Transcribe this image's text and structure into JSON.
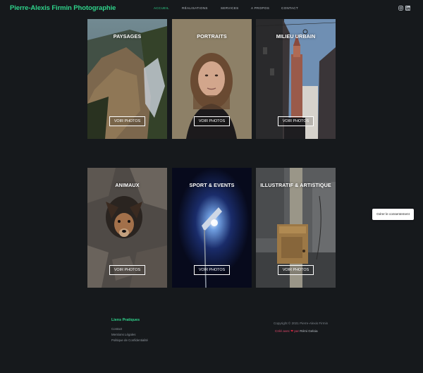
{
  "header": {
    "site_title": "Pierre-Alexis Firmin Photographie",
    "nav": [
      {
        "label": "ACCUEIL",
        "active": true
      },
      {
        "label": "RÉALISATIONS",
        "active": false
      },
      {
        "label": "SERVICES",
        "active": false
      },
      {
        "label": "A PROPOS",
        "active": false
      },
      {
        "label": "CONTACT",
        "active": false
      }
    ],
    "social_icons": [
      "instagram-icon",
      "linkedin-icon"
    ]
  },
  "gallery": {
    "cards": [
      {
        "title": "PAYSAGES",
        "button": "VOIR PHOTOS"
      },
      {
        "title": "PORTRAITS",
        "button": "VOIR PHOTOS"
      },
      {
        "title": "MILIEU URBAIN",
        "button": "VOIR PHOTOS"
      },
      {
        "title": "ANIMAUX",
        "button": "VOIR PHOTOS"
      },
      {
        "title": "SPORT & EVENTS",
        "button": "VOIR PHOTOS"
      },
      {
        "title": "ILLUSTRATIF & ARTISTIQUE",
        "button": "VOIR PHOTOS"
      }
    ]
  },
  "consent": {
    "label": "Gérer le consentement"
  },
  "footer": {
    "heading": "Liens Pratiques",
    "links": [
      "Contact",
      "Mentions Légales",
      "Politique de Confidentialité"
    ],
    "copyright": "Copyright © 2021 Pierre-Alexis Firmin",
    "credit_prefix": "Créé avec",
    "credit_heart": "❤",
    "credit_middle": "par",
    "credit_name": "Rémi Geloia"
  },
  "colors": {
    "accent": "#2fd38b",
    "background": "#16191c",
    "heart": "#e0243f"
  }
}
